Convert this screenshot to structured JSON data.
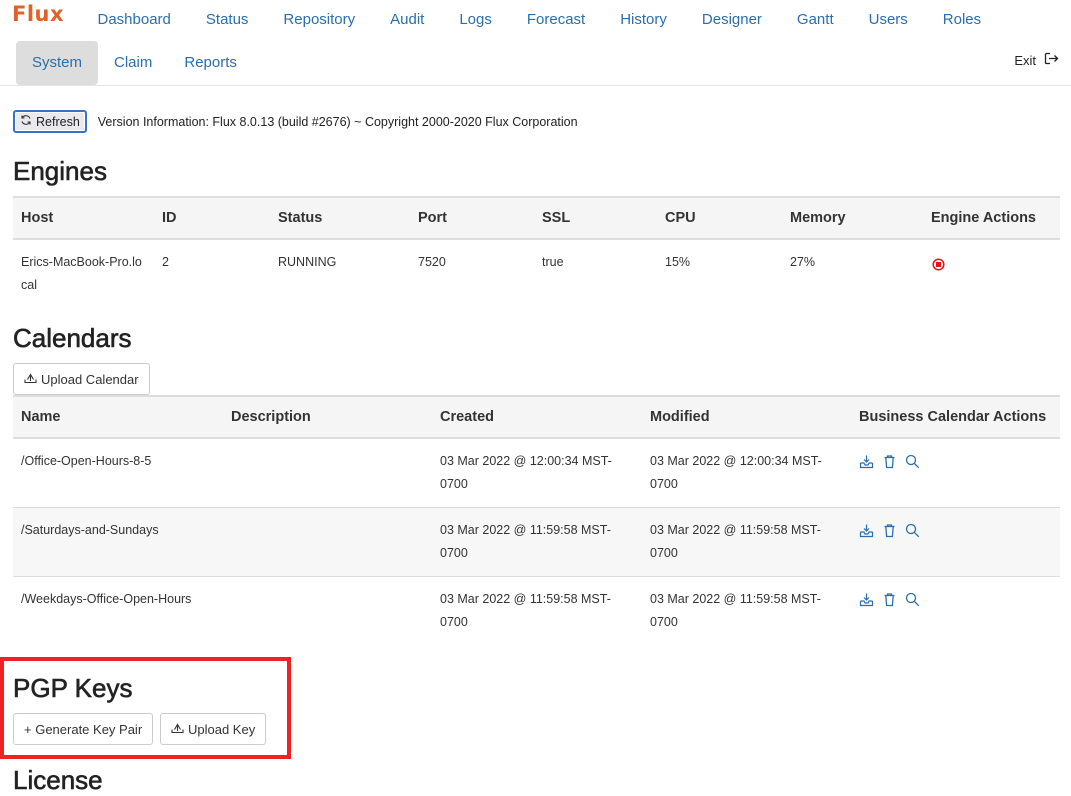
{
  "app": {
    "logo": "Flux",
    "brand_color": "#e0622b",
    "link_color": "#2a6eac"
  },
  "nav": {
    "primary": [
      {
        "label": "Dashboard"
      },
      {
        "label": "Status"
      },
      {
        "label": "Repository"
      },
      {
        "label": "Audit"
      },
      {
        "label": "Logs"
      },
      {
        "label": "Forecast"
      },
      {
        "label": "History"
      },
      {
        "label": "Designer"
      },
      {
        "label": "Gantt"
      },
      {
        "label": "Users"
      },
      {
        "label": "Roles"
      }
    ],
    "secondary": [
      {
        "label": "System",
        "active": true
      },
      {
        "label": "Claim"
      },
      {
        "label": "Reports"
      }
    ],
    "exit_label": "Exit",
    "exit_icon": "sign-out-icon"
  },
  "toolbar": {
    "refresh_label": "Refresh",
    "refresh_icon": "refresh-icon",
    "version_text": "Version Information:  Flux 8.0.13 (build #2676) ~ Copyright 2000-2020 Flux Corporation"
  },
  "engines": {
    "title": "Engines",
    "columns": [
      "Host",
      "ID",
      "Status",
      "Port",
      "SSL",
      "CPU",
      "Memory",
      "Engine Actions"
    ],
    "rows": [
      {
        "host": "Erics-MacBook-Pro.local",
        "id": "2",
        "status": "RUNNING",
        "port": "7520",
        "ssl": "true",
        "cpu": "15%",
        "memory": "27%",
        "action_icon": "stop-circle-icon",
        "action_color": "#ee1111"
      }
    ]
  },
  "calendars": {
    "title": "Calendars",
    "upload_label": "Upload Calendar",
    "upload_icon": "upload-icon",
    "columns": [
      "Name",
      "Description",
      "Created",
      "Modified",
      "Business Calendar Actions"
    ],
    "rows": [
      {
        "name": "/Office-Open-Hours-8-5",
        "description": "",
        "created": "03 Mar 2022 @ 12:00:34 MST-0700",
        "modified": "03 Mar 2022 @ 12:00:34 MST-0700"
      },
      {
        "name": "/Saturdays-and-Sundays",
        "description": "",
        "created": "03 Mar 2022 @ 11:59:58 MST-0700",
        "modified": "03 Mar 2022 @ 11:59:58 MST-0700"
      },
      {
        "name": "/Weekdays-Office-Open-Hours",
        "description": "",
        "created": "03 Mar 2022 @ 11:59:58 MST-0700",
        "modified": "03 Mar 2022 @ 11:59:58 MST-0700"
      }
    ],
    "row_actions": [
      "download-icon",
      "trash-icon",
      "search-icon"
    ]
  },
  "pgp": {
    "title": "PGP Keys",
    "generate_label": "+ Generate Key Pair",
    "upload_label": "Upload Key",
    "upload_icon": "upload-icon"
  },
  "license": {
    "title": "License"
  },
  "annotation": {
    "highlight_color": "#ee2222"
  }
}
